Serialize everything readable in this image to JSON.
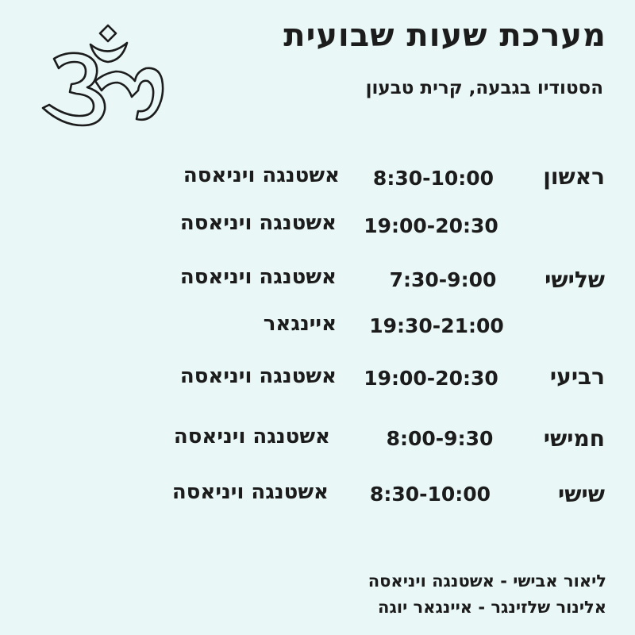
{
  "header": {
    "title": "מערכת שעות שבועית",
    "subtitle": "הסטודיו בגבעה, קרית טבעון",
    "logo_icon": "om-icon"
  },
  "schedule": [
    {
      "day": "ראשון",
      "time": "8:30-10:00",
      "class": "אשטנגה ויניאסה"
    },
    {
      "day": "",
      "time": "19:00-20:30",
      "class": "אשטנגה ויניאסה"
    },
    {
      "day": "שלישי",
      "time": "7:30-9:00",
      "class": "אשטנגה ויניאסה"
    },
    {
      "day": "",
      "time": "19:30-21:00",
      "class": "איינגאר"
    },
    {
      "day": "רביעי",
      "time": "19:00-20:30",
      "class": "אשטנגה ויניאסה"
    },
    {
      "day": "חמישי",
      "time": "8:00-9:30",
      "class": "אשטנגה ויניאסה"
    },
    {
      "day": "שישי",
      "time": "8:30-10:00",
      "class": "אשטנגה ויניאסה"
    }
  ],
  "footer": {
    "teacher_1": "ליאור אבישי - אשטנגה ויניאסה",
    "teacher_2": "אלינור שלזינגר - איינגאר יוגה"
  },
  "colors": {
    "background": "#e9f7f7",
    "text": "#1c1c1c"
  }
}
